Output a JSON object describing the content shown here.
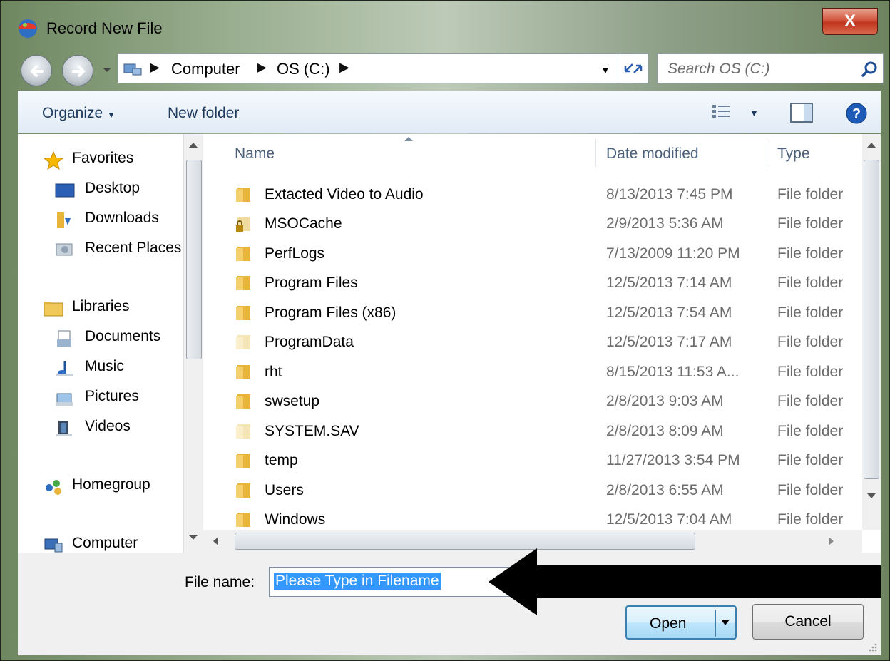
{
  "window": {
    "title": "Record New File",
    "close_glyph": "X"
  },
  "nav": {
    "breadcrumbs": [
      "Computer",
      "OS (C:)"
    ],
    "search_placeholder": "Search OS (C:)"
  },
  "toolbar": {
    "organize": "Organize",
    "new_folder": "New folder"
  },
  "sidebar": {
    "items": [
      {
        "label": "Favorites",
        "icon": "star-icon"
      },
      {
        "label": "Desktop",
        "icon": "desktop-icon"
      },
      {
        "label": "Downloads",
        "icon": "downloads-icon"
      },
      {
        "label": "Recent Places",
        "icon": "recent-places-icon"
      },
      {
        "label": "Libraries",
        "icon": "libraries-icon"
      },
      {
        "label": "Documents",
        "icon": "documents-icon"
      },
      {
        "label": "Music",
        "icon": "music-icon"
      },
      {
        "label": "Pictures",
        "icon": "pictures-icon"
      },
      {
        "label": "Videos",
        "icon": "videos-icon"
      },
      {
        "label": "Homegroup",
        "icon": "homegroup-icon"
      },
      {
        "label": "Computer",
        "icon": "computer-icon"
      }
    ]
  },
  "files": {
    "columns": {
      "name": "Name",
      "date": "Date modified",
      "type": "Type"
    },
    "rows": [
      {
        "name": "Extacted Video to Audio",
        "date": "8/13/2013 7:45 PM",
        "type": "File folder"
      },
      {
        "name": "MSOCache",
        "date": "2/9/2013 5:36 AM",
        "type": "File folder"
      },
      {
        "name": "PerfLogs",
        "date": "7/13/2009 11:20 PM",
        "type": "File folder"
      },
      {
        "name": "Program Files",
        "date": "12/5/2013 7:14 AM",
        "type": "File folder"
      },
      {
        "name": "Program Files (x86)",
        "date": "12/5/2013 7:54 AM",
        "type": "File folder"
      },
      {
        "name": "ProgramData",
        "date": "12/5/2013 7:17 AM",
        "type": "File folder"
      },
      {
        "name": "rht",
        "date": "8/15/2013 11:53 A...",
        "type": "File folder"
      },
      {
        "name": "swsetup",
        "date": "2/8/2013 9:03 AM",
        "type": "File folder"
      },
      {
        "name": "SYSTEM.SAV",
        "date": "2/8/2013 8:09 AM",
        "type": "File folder"
      },
      {
        "name": "temp",
        "date": "11/27/2013 3:54 PM",
        "type": "File folder"
      },
      {
        "name": "Users",
        "date": "2/8/2013 6:55 AM",
        "type": "File folder"
      },
      {
        "name": "Windows",
        "date": "12/5/2013 7:04 AM",
        "type": "File folder"
      }
    ]
  },
  "bottom": {
    "filename_label": "File name:",
    "filename_value": "Please Type in Filename",
    "open": "Open",
    "cancel": "Cancel"
  },
  "colors": {
    "accent": "#3399ff",
    "folder": "#e8b53a",
    "header_text": "#4c607a"
  }
}
